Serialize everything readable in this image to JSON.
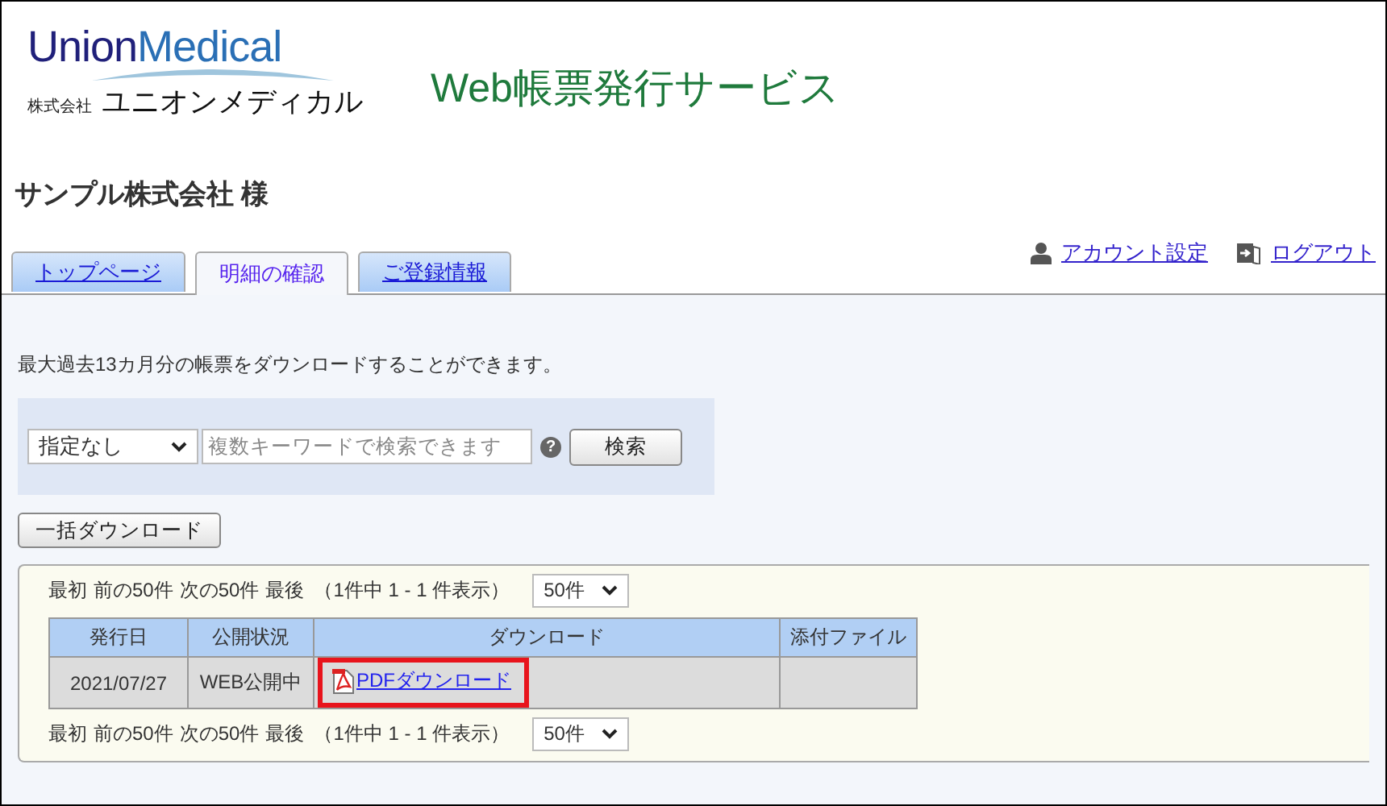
{
  "logo": {
    "wordmark_left": "Union",
    "wordmark_right": "Medical",
    "company_prefix": "株式会社",
    "company_name": "ユニオンメディカル"
  },
  "service_title": "Web帳票発行サービス",
  "customer": "サンプル株式会社 様",
  "tabs": [
    {
      "label": "トップページ",
      "selected": false
    },
    {
      "label": "明細の確認",
      "selected": true
    },
    {
      "label": "ご登録情報",
      "selected": false
    }
  ],
  "header_links": [
    {
      "kind": "account",
      "label": "アカウント設定"
    },
    {
      "kind": "logout",
      "label": "ログアウト"
    }
  ],
  "notice": "最大過去13カ月分の帳票をダウンロードすることができます。",
  "search": {
    "category": "指定なし",
    "placeholder": "複数キーワードで検索できます",
    "help": "?",
    "button": "検索"
  },
  "bulk_button": "一括ダウンロード",
  "pager_top": {
    "items": [
      "最初",
      "前の50件",
      "次の50件",
      "最後"
    ],
    "summary": "（1件中 1 - 1 件表示）",
    "per_page": "50件"
  },
  "table": {
    "columns": [
      "発行日",
      "公開状況",
      "ダウンロード",
      "添付ファイル"
    ],
    "rows": [
      {
        "date": "2021/07/27",
        "status": "WEB公開中",
        "download": "PDFダウンロード",
        "highlighted": true
      }
    ]
  },
  "pager_bottom": {
    "items": [
      "最初",
      "前の50件",
      "次の50件",
      "最後"
    ],
    "summary": "（1件中 1 - 1 件表示）",
    "per_page": "50件"
  }
}
